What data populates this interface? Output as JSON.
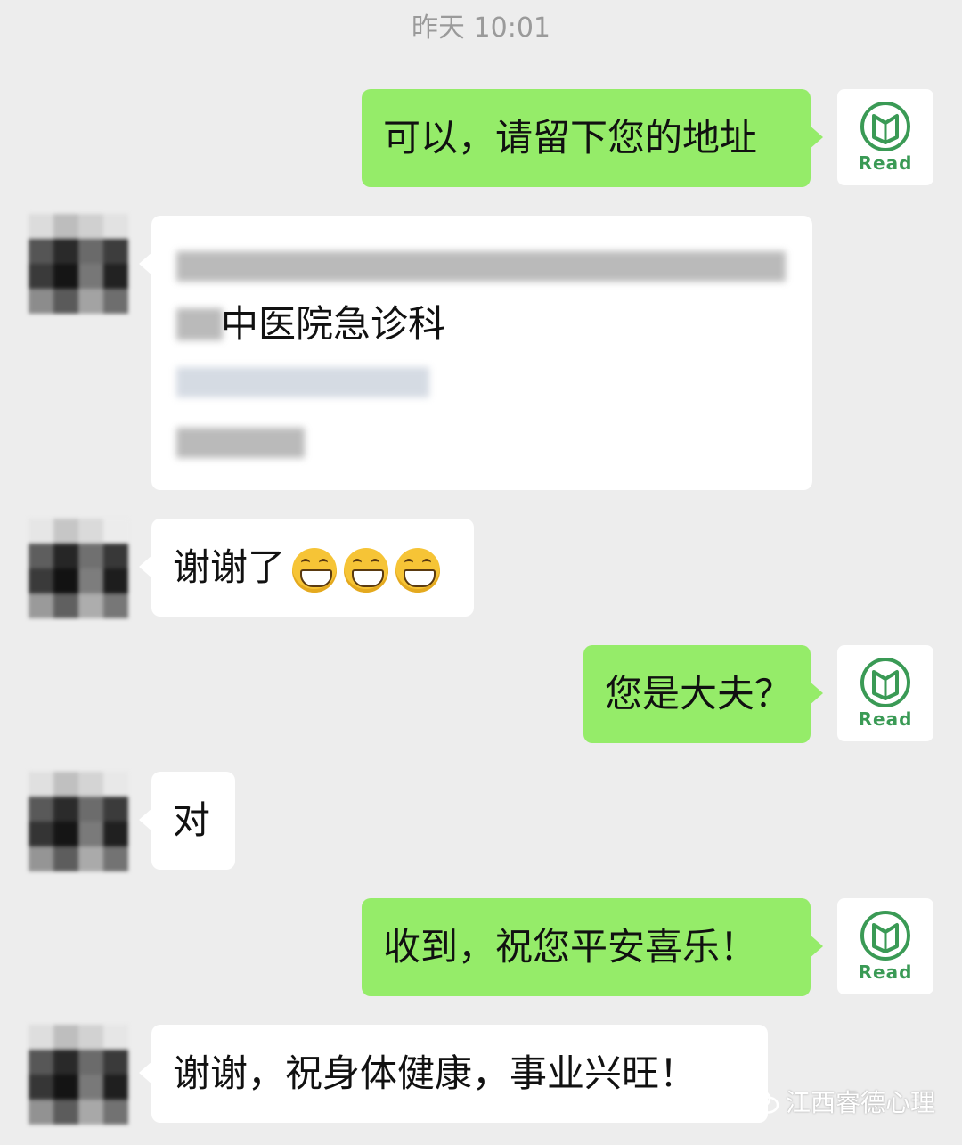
{
  "timestamp": "昨天 10:01",
  "self_avatar": {
    "logo_text": "Read",
    "icon": "book-logo-icon",
    "accent": "#3a9a55"
  },
  "colors": {
    "outgoing_bubble": "#95ec69",
    "incoming_bubble": "#ffffff",
    "background": "#ededed"
  },
  "messages": [
    {
      "side": "out",
      "text": "可以，请留下您的地址"
    },
    {
      "side": "in",
      "text": "中医院急诊科"
    },
    {
      "side": "in",
      "text": "谢谢了",
      "emojis": [
        "grin-emoji",
        "grin-emoji",
        "grin-emoji"
      ]
    },
    {
      "side": "out",
      "text": "您是大夫？"
    },
    {
      "side": "in",
      "text": "对"
    },
    {
      "side": "out",
      "text": "收到，祝您平安喜乐！"
    },
    {
      "side": "in",
      "text": "谢谢，祝身体健康，事业兴旺！"
    }
  ],
  "watermark": {
    "text": "江西睿德心理",
    "icon": "wechat-icon"
  }
}
